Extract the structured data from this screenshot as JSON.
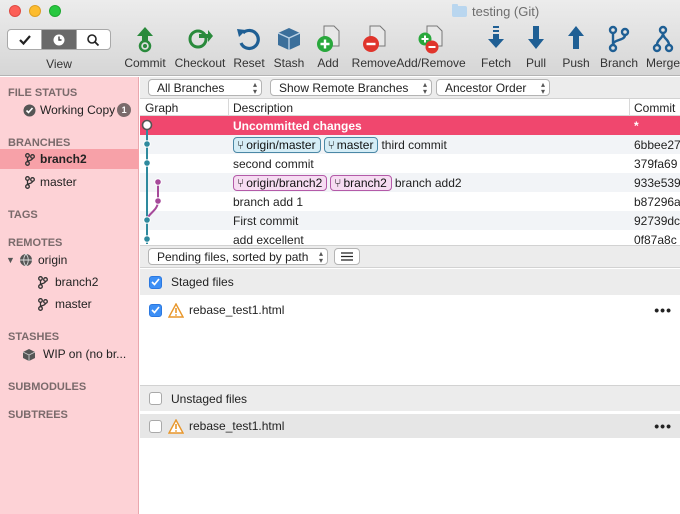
{
  "window": {
    "title": "testing (Git)"
  },
  "toolbar": {
    "view_label": "View",
    "buttons": [
      {
        "label": "Commit",
        "icon": "commit-icon"
      },
      {
        "label": "Checkout",
        "icon": "checkout-icon"
      },
      {
        "label": "Reset",
        "icon": "reset-icon"
      },
      {
        "label": "Stash",
        "icon": "stash-icon"
      },
      {
        "label": "Add",
        "icon": "add-icon"
      },
      {
        "label": "Remove",
        "icon": "remove-icon"
      },
      {
        "label": "Add/Remove",
        "icon": "add-remove-icon"
      },
      {
        "label": "Fetch",
        "icon": "fetch-icon"
      },
      {
        "label": "Pull",
        "icon": "pull-icon"
      },
      {
        "label": "Push",
        "icon": "push-icon"
      },
      {
        "label": "Branch",
        "icon": "branch-icon"
      },
      {
        "label": "Merge",
        "icon": "merge-icon"
      }
    ]
  },
  "sidebar": {
    "file_status": {
      "header": "FILE STATUS",
      "working_copy": "Working Copy",
      "badge": "1"
    },
    "branches": {
      "header": "BRANCHES",
      "items": [
        "branch2",
        "master"
      ],
      "selected": "branch2"
    },
    "tags": {
      "header": "TAGS"
    },
    "remotes": {
      "header": "REMOTES",
      "origin": "origin",
      "items": [
        "branch2",
        "master"
      ]
    },
    "stashes": {
      "header": "STASHES",
      "items": [
        "WIP on (no br..."
      ]
    },
    "submodules": {
      "header": "SUBMODULES"
    },
    "subtrees": {
      "header": "SUBTREES"
    }
  },
  "filters": {
    "branches": "All Branches",
    "remote": "Show Remote Branches",
    "order": "Ancestor Order"
  },
  "history": {
    "columns": {
      "graph": "Graph",
      "description": "Description",
      "commit": "Commit"
    },
    "rows": [
      {
        "desc": "Uncommitted changes",
        "hash": "*",
        "tags": []
      },
      {
        "desc": "third commit",
        "hash": "6bbee27",
        "tags": [
          {
            "text": "origin/master",
            "style": "blue"
          },
          {
            "text": "master",
            "style": "blue"
          }
        ]
      },
      {
        "desc": "second commit",
        "hash": "379fa69",
        "tags": []
      },
      {
        "desc": "branch add2",
        "hash": "933e539",
        "tags": [
          {
            "text": "origin/branch2",
            "style": "pink"
          },
          {
            "text": "branch2",
            "style": "pink"
          }
        ]
      },
      {
        "desc": "branch add 1",
        "hash": "b87296a",
        "tags": []
      },
      {
        "desc": "First commit",
        "hash": "92739dc",
        "tags": []
      },
      {
        "desc": "add excellent",
        "hash": "0f87a8c",
        "tags": []
      }
    ]
  },
  "files": {
    "sort_label": "Pending files, sorted by path",
    "staged": {
      "header": "Staged files",
      "checked": true,
      "items": [
        {
          "name": "rebase_test1.html",
          "checked": true,
          "status": "warning"
        }
      ]
    },
    "unstaged": {
      "header": "Unstaged files",
      "checked": false,
      "items": [
        {
          "name": "rebase_test1.html",
          "checked": false,
          "status": "warning"
        }
      ]
    }
  },
  "colors": {
    "sidebar": "#fdd2d6",
    "selection": "#f7a1a8",
    "uncommitted": "#f0476e",
    "graph_master": "#2e8a9e",
    "graph_branch": "#a64a9a"
  }
}
